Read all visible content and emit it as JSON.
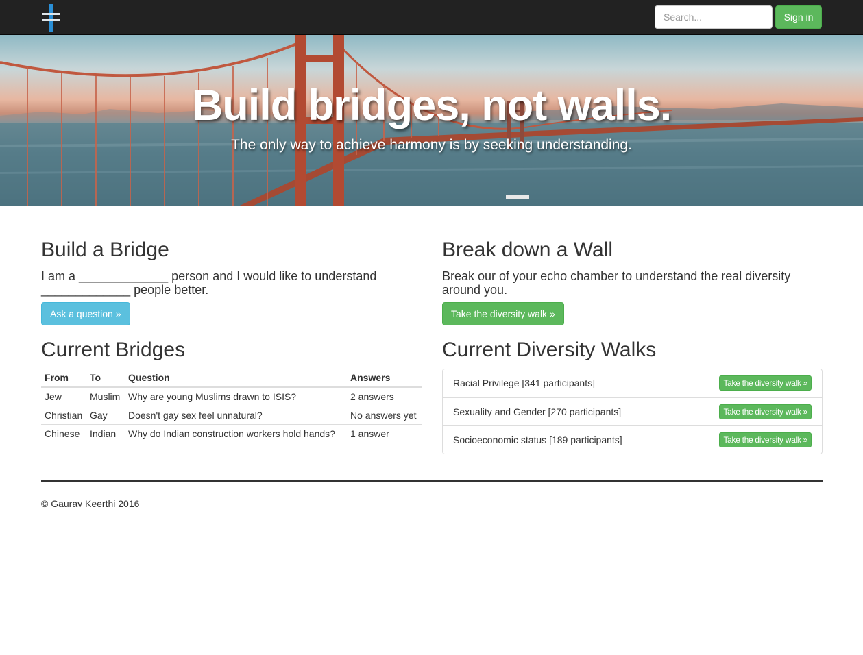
{
  "navbar": {
    "logo_icon": "bridge-logo-icon",
    "search_placeholder": "Search...",
    "signin_label": "Sign in",
    "colors": {
      "background": "#222222",
      "logo_accent": "#2a8fd6",
      "success": "#5cb85c"
    }
  },
  "hero": {
    "title": "Build bridges, not walls.",
    "subtitle": "The only way to achieve harmony is by seeking understanding."
  },
  "bridge": {
    "heading": "Build a Bridge",
    "lead": "I am a _____________ person and I would like to understand _____________ people better.",
    "button": "Ask a question »"
  },
  "wall": {
    "heading": "Break down a Wall",
    "lead": "Break our of your echo chamber to understand the real diversity around you.",
    "button": "Take the diversity walk »"
  },
  "current_bridges": {
    "heading": "Current Bridges",
    "columns": [
      "From",
      "To",
      "Question",
      "Answers"
    ],
    "rows": [
      [
        "Jew",
        "Muslim",
        "Why are young Muslims drawn to ISIS?",
        "2 answers"
      ],
      [
        "Christian",
        "Gay",
        "Doesn't gay sex feel unnatural?",
        "No answers yet"
      ],
      [
        "Chinese",
        "Indian",
        "Why do Indian construction workers hold hands?",
        "1 answer"
      ]
    ]
  },
  "current_walks": {
    "heading": "Current Diversity Walks",
    "items": [
      {
        "label": "Racial Privilege [341 participants]",
        "button": "Take the diversity walk »"
      },
      {
        "label": "Sexuality and Gender [270 participants]",
        "button": "Take the diversity walk »"
      },
      {
        "label": "Socioeconomic status [189 participants]",
        "button": "Take the diversity walk »"
      }
    ]
  },
  "footer": {
    "text": "© Gaurav Keerthi 2016"
  }
}
